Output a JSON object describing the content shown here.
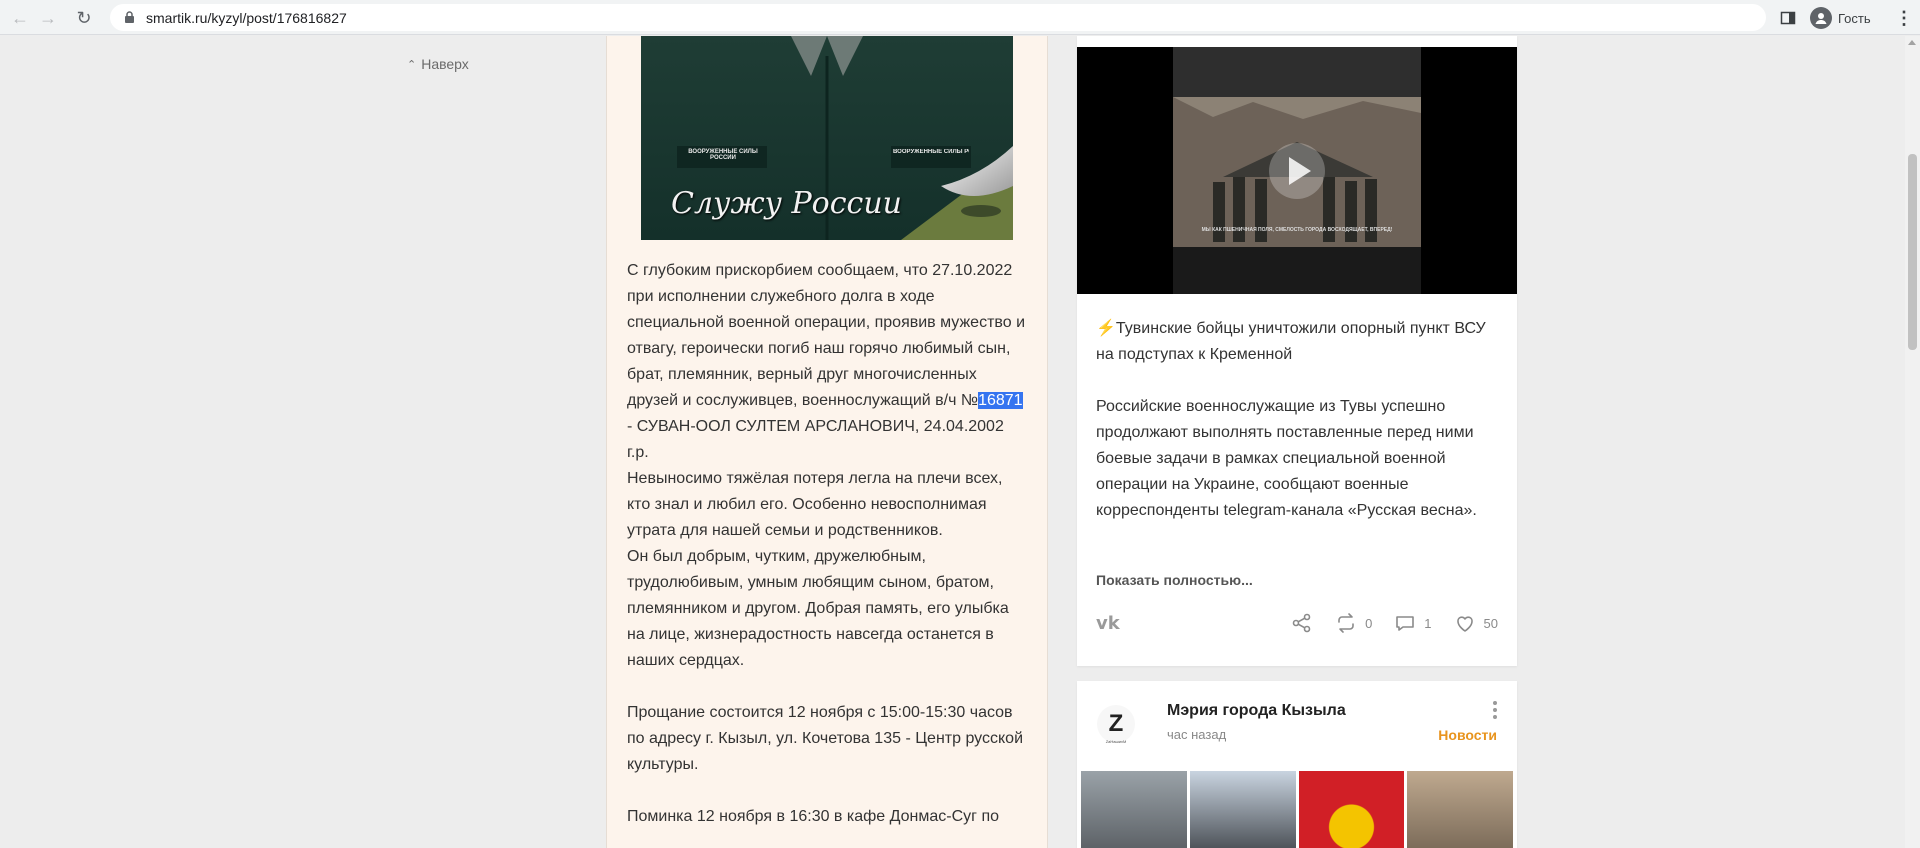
{
  "browser": {
    "url": "smartik.ru/kyzyl/post/176816827",
    "profile_label": "Гость"
  },
  "page": {
    "to_top_label": "Наверх"
  },
  "article": {
    "image_caption": "Служу России",
    "patch_text": "ВООРУЖЕННЫЕ СИЛЫ РОССИИ",
    "p1_before": "С глубоким прискорбием сообщаем, что 27.10.2022 при исполнении служебного долга в ходе специальной военной операции, проявив мужество и отвагу, героически погиб наш горячо любимый сын, брат, племянник, верный друг многочисленных друзей и сослуживцев, военнослужащий в/ч №",
    "p1_highlight": "16871",
    "p1_after": " - СУВАН-ООЛ СУЛТЕМ АРСЛАНОВИЧ, 24.04.2002 г.р.",
    "p2": "Невыносимо тяжёлая потеря легла на плечи всех, кто знал и любил его. Особенно невосполнимая утрата для нашей семьи и родственников.",
    "p3": "Он был добрым, чутким, дружелюбным, трудолюбивым, умным любящим сыном, братом, племянником и другом. Добрая память, его улыбка на лице, жизнерадостность навсегда останется в наших сердцах.",
    "p4": "Прощание состоится 12 ноября с 15:00-15:30 часов по адресу г. Кызыл, ул. Кочетова 135 - Центр русской культуры.",
    "p5": "Поминка 12 ноября в 16:30 в кафе Донмас-Суг по"
  },
  "feed": {
    "card1": {
      "video_caption": "МЫ КАК ПШЕНИЧНАЯ ПОЛЯ, СМЕЛОСТЬ ГОРОДА ВОСХОДЯЩАЕТ, ВПЕРЕД!",
      "title_emoji": "⚡",
      "title": "Тувинские бойцы уничтожили опорный пункт ВСУ на подступах к Кременной",
      "body": "Российские военнослужащие из Тувы успешно продолжают выполнять поставленные перед ними боевые задачи в рамках специальной военной операции на Украине, сообщают военные корреспонденты telegram-канала «Русская весна».",
      "show_more": "Показать полностью...",
      "vk_label": "vk",
      "reposts": "0",
      "comments": "1",
      "likes": "50"
    },
    "card2": {
      "logo_letter": "Z",
      "logo_caption": "ZаНашихМ",
      "source_name": "Мэрия города Кызыла",
      "time": "час назад",
      "category": "Новости"
    }
  },
  "colors": {
    "highlight": "#3574f0",
    "category": "#e8941e",
    "article_bg": "#fdf4ec",
    "page_bg": "#ededed"
  }
}
